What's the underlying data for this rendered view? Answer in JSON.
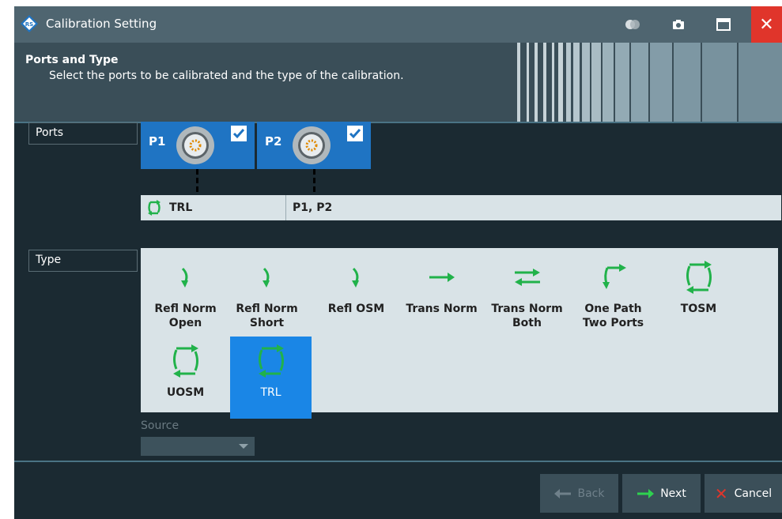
{
  "window": {
    "title": "Calibration Setting"
  },
  "header": {
    "title": "Ports and Type",
    "subtitle": "Select the ports to be calibrated and the type of the calibration."
  },
  "ports": {
    "section_label": "Ports",
    "items": [
      {
        "name": "P1",
        "checked": true
      },
      {
        "name": "P2",
        "checked": true
      }
    ]
  },
  "calibration_row": {
    "type": "TRL",
    "ports": "P1, P2"
  },
  "type": {
    "section_label": "Type",
    "options": [
      {
        "label": "Refl Norm Open",
        "icon": "refl-norm-open-icon"
      },
      {
        "label": "Refl Norm Short",
        "icon": "refl-norm-short-icon"
      },
      {
        "label": "Refl OSM",
        "icon": "refl-osm-icon"
      },
      {
        "label": "Trans Norm",
        "icon": "trans-norm-icon"
      },
      {
        "label": "Trans Norm Both",
        "icon": "trans-norm-both-icon"
      },
      {
        "label": "One Path Two Ports",
        "icon": "one-path-two-ports-icon"
      },
      {
        "label": "TOSM",
        "icon": "tosm-icon"
      },
      {
        "label": "UOSM",
        "icon": "uosm-icon"
      },
      {
        "label": "TRL",
        "icon": "trl-icon",
        "selected": true
      }
    ],
    "labels": {
      "refl_norm_open_1": "Refl Norm",
      "refl_norm_open_2": "Open",
      "refl_norm_short_1": "Refl Norm",
      "refl_norm_short_2": "Short",
      "refl_osm": "Refl OSM",
      "trans_norm": "Trans Norm",
      "trans_norm_both_1": "Trans Norm",
      "trans_norm_both_2": "Both",
      "one_path_1": "One Path",
      "one_path_2": "Two Ports",
      "tosm": "TOSM",
      "uosm": "UOSM",
      "trl": "TRL"
    }
  },
  "source": {
    "label": "Source",
    "value": ""
  },
  "buttons": {
    "back": "Back",
    "next": "Next",
    "cancel": "Cancel"
  },
  "colors": {
    "accent_blue": "#1f74c3",
    "selected_blue": "#1a86e6",
    "icon_green": "#21b24a",
    "close_red": "#e0352b"
  }
}
